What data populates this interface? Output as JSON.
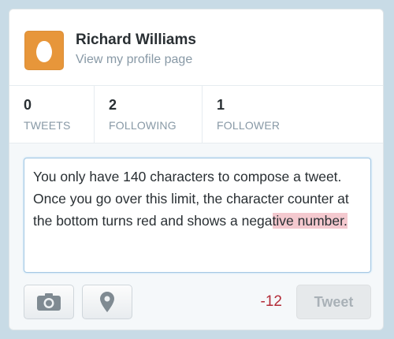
{
  "profile": {
    "name": "Richard Williams",
    "link_text": "View my profile page"
  },
  "stats": [
    {
      "value": "0",
      "label": "TWEETS"
    },
    {
      "value": "2",
      "label": "FOLLOWING"
    },
    {
      "value": "1",
      "label": "FOLLOWER"
    }
  ],
  "composer": {
    "text_within_limit": "You only have 140 characters to compose a tweet. Once you go over this limit, the character counter at the bottom turns red and shows a nega",
    "text_over_limit": "tive number."
  },
  "toolbar": {
    "photo_icon": "camera-icon",
    "location_icon": "location-pin-icon",
    "counter": "-12",
    "tweet_label": "Tweet"
  },
  "colors": {
    "avatar_bg": "#e7963a",
    "counter_negative": "#b32c38",
    "overflow_highlight": "#f4c9cf",
    "input_border": "#a6c8e3"
  }
}
